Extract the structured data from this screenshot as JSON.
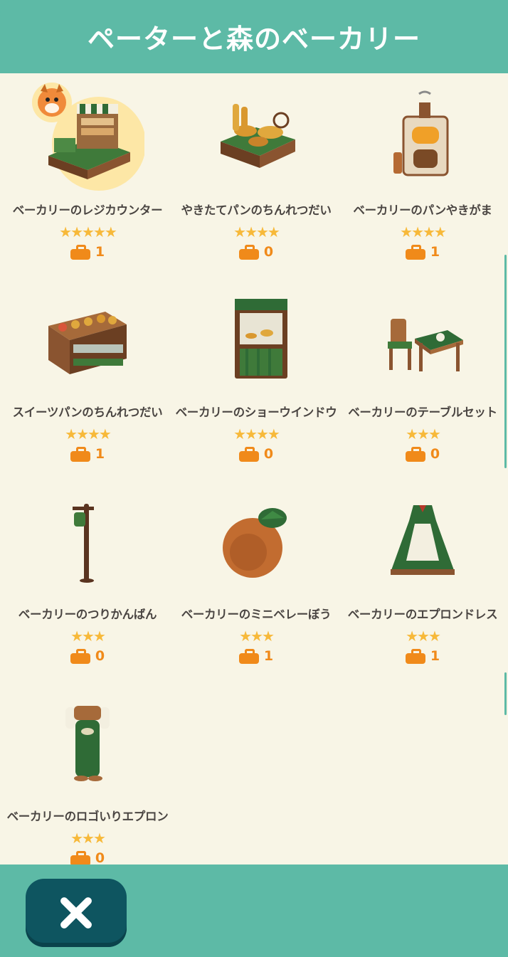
{
  "header": {
    "title": "ペーターと森のベーカリー"
  },
  "items": [
    {
      "name": "ベーカリーのレジカウンター",
      "stars": "★★★★★",
      "count": "1",
      "icon": "register-counter-icon"
    },
    {
      "name": "やきたてパンのちんれつだい",
      "stars": "★★★★",
      "count": "0",
      "icon": "bread-display-stand-icon"
    },
    {
      "name": "ベーカリーのパンやきがま",
      "stars": "★★★★",
      "count": "1",
      "icon": "bread-oven-icon"
    },
    {
      "name": "スイーツパンのちんれつだい",
      "stars": "★★★★",
      "count": "1",
      "icon": "sweets-bread-case-icon"
    },
    {
      "name": "ベーカリーのショーウインドウ",
      "stars": "★★★★",
      "count": "0",
      "icon": "show-window-icon"
    },
    {
      "name": "ベーカリーのテーブルセット",
      "stars": "★★★",
      "count": "0",
      "icon": "table-set-icon"
    },
    {
      "name": "ベーカリーのつりかんばん",
      "stars": "★★★",
      "count": "0",
      "icon": "hanging-sign-icon"
    },
    {
      "name": "ベーカリーのミニベレーぼう",
      "stars": "★★★",
      "count": "1",
      "icon": "mini-beret-icon"
    },
    {
      "name": "ベーカリーのエプロンドレス",
      "stars": "★★★",
      "count": "1",
      "icon": "apron-dress-icon"
    },
    {
      "name": "ベーカリーのロゴいりエプロン",
      "stars": "★★★",
      "count": "0",
      "icon": "logo-apron-icon"
    }
  ],
  "footer": {
    "close_icon": "close-icon"
  },
  "colors": {
    "accent": "#5dbaa6",
    "panel": "#f8f5e6",
    "star": "#f7b93a",
    "bag": "#f08a1a",
    "close_button": "#0e5560"
  }
}
